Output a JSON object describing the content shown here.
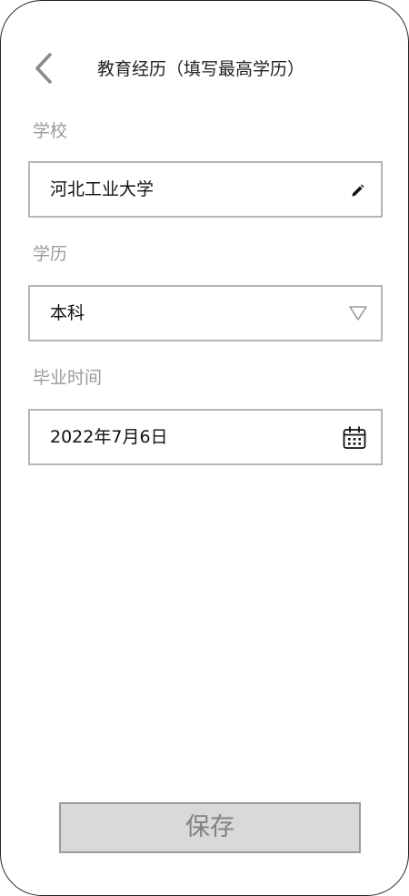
{
  "header": {
    "back_icon": "chevron-left-icon",
    "title": "教育经历（填写最高学历）"
  },
  "form": {
    "school": {
      "label": "学校",
      "value": "河北工业大学",
      "icon": "pencil-icon"
    },
    "degree": {
      "label": "学历",
      "value": "本科",
      "icon": "triangle-down-icon"
    },
    "graduation": {
      "label": "毕业时间",
      "value": "2022年7月6日",
      "icon": "calendar-icon"
    }
  },
  "footer": {
    "save_label": "保存"
  },
  "colors": {
    "border": "#b5b5b5",
    "label": "#9a9a9a",
    "button_bg": "#d9d9d9",
    "button_text": "#808080"
  }
}
